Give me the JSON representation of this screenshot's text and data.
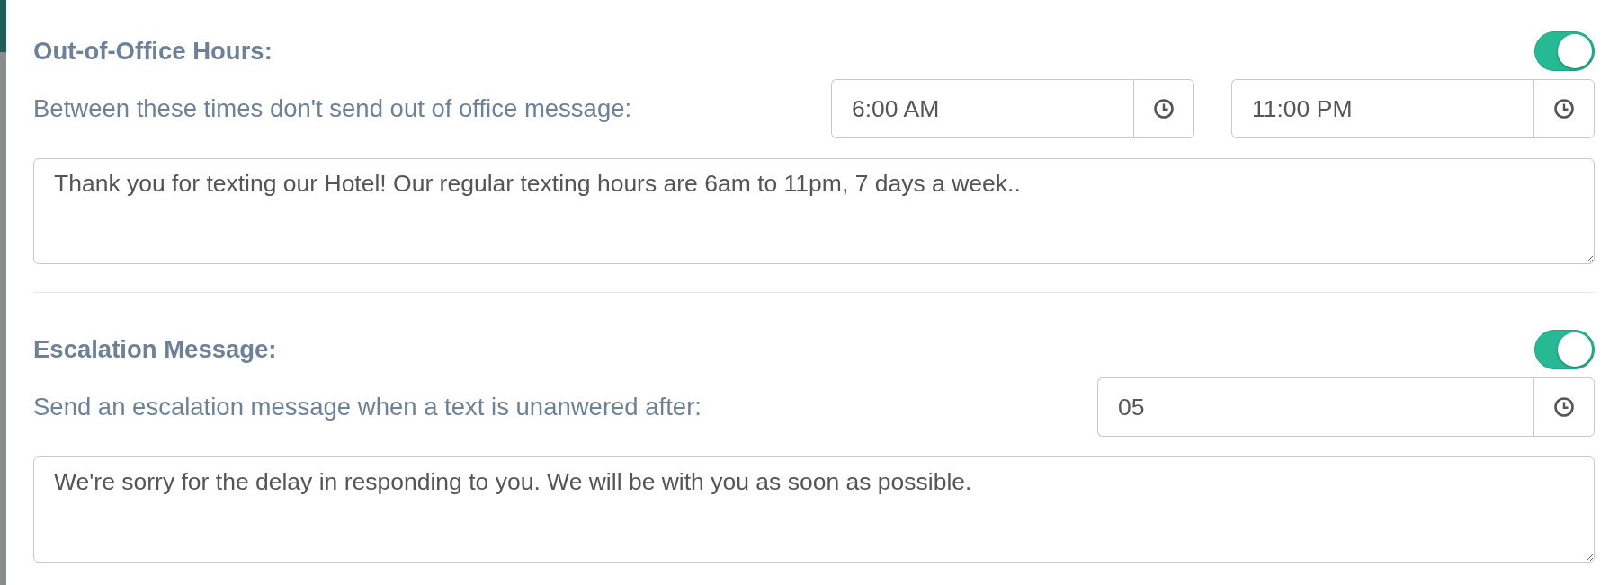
{
  "sections": [
    {
      "title": "Out-of-Office Hours:",
      "enabled": true,
      "description": "Between these times don't send out of office message:",
      "time_fields": [
        {
          "value": "6:00 AM"
        },
        {
          "value": "11:00 PM"
        }
      ],
      "message": "Thank you for texting our Hotel! Our regular texting hours are 6am to 11pm, 7 days a week.."
    },
    {
      "title": "Escalation Message:",
      "enabled": true,
      "description": "Send an escalation message when a text is unanwered after:",
      "time_fields": [
        {
          "value": "05"
        }
      ],
      "message": "We're sorry for the delay in responding to you. We will be with you as soon as possible."
    }
  ]
}
